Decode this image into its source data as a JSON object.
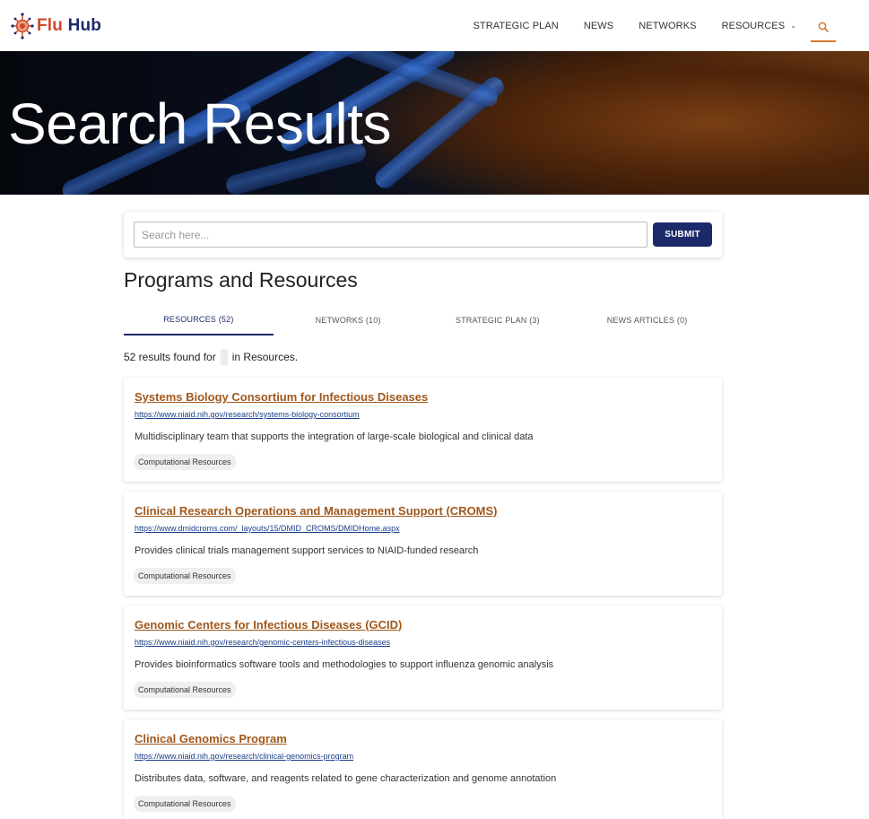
{
  "header": {
    "logo": {
      "flu": "Flu",
      "hub": "Hub"
    },
    "nav": [
      {
        "label": "STRATEGIC PLAN"
      },
      {
        "label": "NEWS"
      },
      {
        "label": "NETWORKS"
      },
      {
        "label": "RESOURCES"
      }
    ]
  },
  "hero": {
    "title": "Search Results"
  },
  "search": {
    "placeholder": "Search here...",
    "submit_label": "SUBMIT"
  },
  "section_title": "Programs and Resources",
  "tabs": [
    {
      "label": "RESOURCES (52)",
      "active": true
    },
    {
      "label": "NETWORKS (10)",
      "active": false
    },
    {
      "label": "STRATEGIC PLAN (3)",
      "active": false
    },
    {
      "label": "NEWS ARTICLES (0)",
      "active": false
    }
  ],
  "results_summary": {
    "prefix": "52 results found for",
    "suffix": "in Resources."
  },
  "results": [
    {
      "title": "Systems Biology Consortium for Infectious Diseases",
      "url": "https://www.niaid.nih.gov/research/systems-biology-consortium",
      "description": "Multidisciplinary team that supports the integration of large-scale biological and clinical data",
      "tag": "Computational Resources"
    },
    {
      "title": "Clinical Research Operations and Management Support (CROMS)",
      "url": "https://www.dmidcroms.com/_layouts/15/DMID_CROMS/DMIDHome.aspx",
      "description": "Provides clinical trials management support services to NIAID-funded research",
      "tag": "Computational Resources"
    },
    {
      "title": "Genomic Centers for Infectious Diseases (GCID)",
      "url": "https://www.niaid.nih.gov/research/genomic-centers-infectious-diseases",
      "description": "Provides bioinformatics software tools and methodologies to support influenza genomic analysis",
      "tag": "Computational Resources"
    },
    {
      "title": "Clinical Genomics Program",
      "url": "https://www.niaid.nih.gov/research/clinical-genomics-program",
      "description": "Distributes data, software, and reagents related to gene characterization and genome annotation",
      "tag": "Computational Resources"
    }
  ],
  "colors": {
    "brand_navy": "#1c2a6b",
    "brand_red": "#d4452a",
    "link_orange": "#a0581d",
    "accent_orange": "#d9772b"
  }
}
